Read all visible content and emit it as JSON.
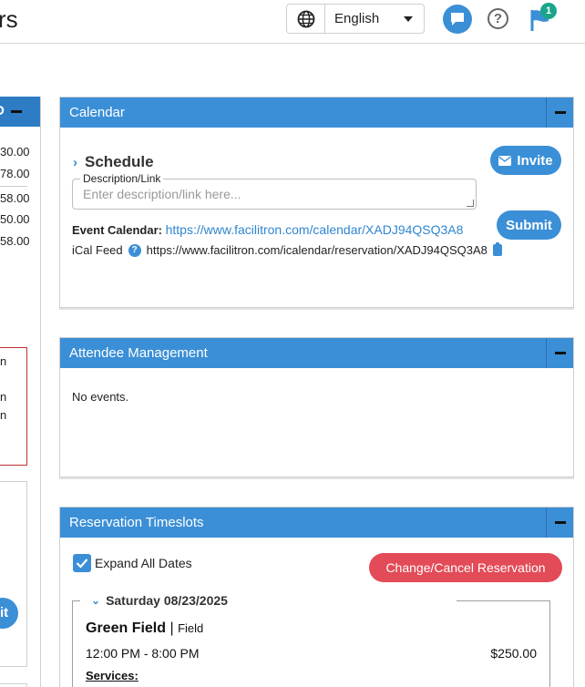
{
  "header": {
    "title_partial": "rs",
    "language": {
      "selected": "English",
      "icon": "globe-icon"
    },
    "icons": {
      "chat": "chat-icon",
      "help": "help-icon",
      "flag": "flag-icon"
    },
    "notifications_count": "1"
  },
  "left_panel": {
    "header_text": "D",
    "amounts": [
      "30.00",
      "78.00",
      "58.00",
      "50.00",
      "58.00"
    ],
    "alert_lines": [
      "n",
      "n",
      "n"
    ],
    "button_text": "it"
  },
  "calendar": {
    "title": "Calendar",
    "invite_label": "Invite",
    "schedule_label": "Schedule",
    "description_label": "Description/Link",
    "description_placeholder": "Enter description/link here...",
    "submit_label": "Submit",
    "event_calendar_label": "Event Calendar:",
    "event_calendar_url": "https://www.facilitron.com/calendar/XADJ94QSQ3A8",
    "ical_label": "iCal Feed",
    "ical_url": "https://www.facilitron.com/icalendar/reservation/XADJ94QSQ3A8"
  },
  "attendee": {
    "title": "Attendee Management",
    "empty_text": "No events."
  },
  "timeslots": {
    "title": "Reservation Timeslots",
    "expand_label": "Expand All Dates",
    "change_label": "Change/Cancel Reservation",
    "date_label": "Saturday 08/23/2025",
    "field_name": "Green Field",
    "field_sep": "|",
    "field_type": "Field",
    "time_range": "12:00 PM - 8:00 PM",
    "price": "$250.00",
    "services_label": "Services:"
  },
  "colors": {
    "primary": "#3b8fd6",
    "danger": "#e24b57",
    "badge": "#1aa58a"
  }
}
